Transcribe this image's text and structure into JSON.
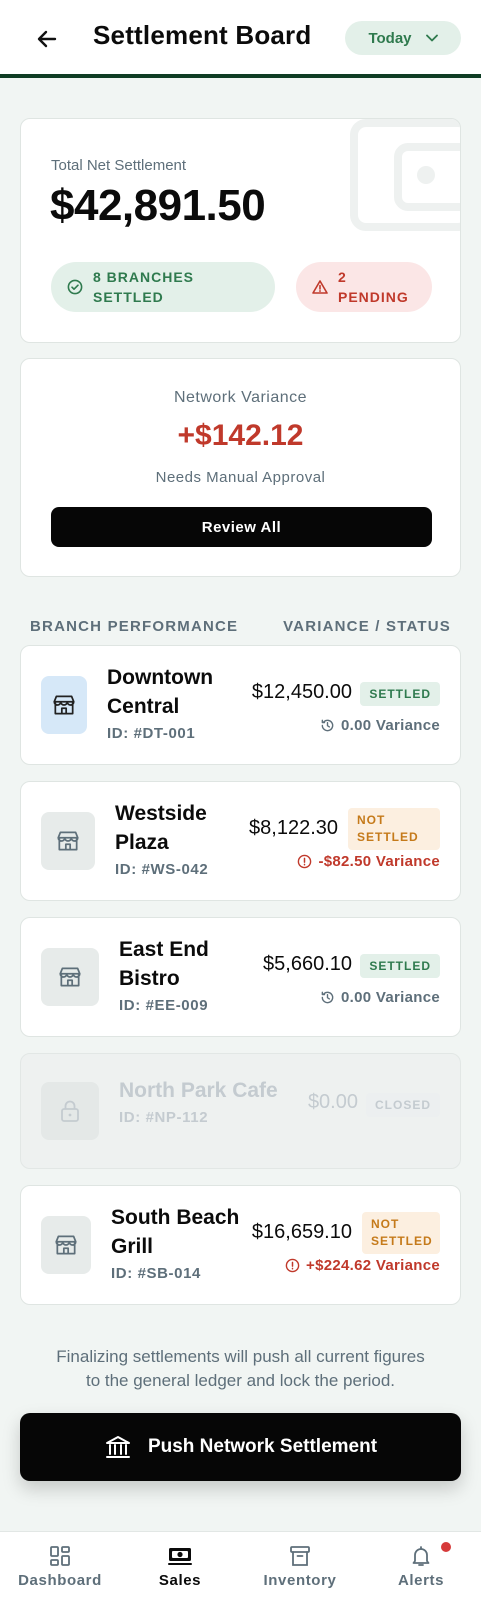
{
  "header": {
    "title": "Settlement Board",
    "date_filter": "Today"
  },
  "summary": {
    "label": "Total Net Settlement",
    "value": "$42,891.50",
    "settled_badge_line1": "8 BRANCHES",
    "settled_badge_line2": "SETTLED",
    "pending_badge_line1": "2",
    "pending_badge_line2": "PENDING"
  },
  "variance": {
    "label": "Network Variance",
    "value": "+$142.12",
    "subtitle": "Needs Manual Approval",
    "review_label": "Review All"
  },
  "section": {
    "left": "BRANCH PERFORMANCE",
    "right": "VARIANCE / STATUS"
  },
  "branches": [
    {
      "name_line1": "Downtown",
      "name_line2": "Central",
      "id": "ID: #DT-001",
      "amount": "$12,450.00",
      "status": "SETTLED",
      "variance": "0.00 Variance"
    },
    {
      "name_line1": "Westside",
      "name_line2": "Plaza",
      "id": "ID: #WS-042",
      "amount": "$8,122.30",
      "status_line1": "NOT",
      "status_line2": "SETTLED",
      "variance": "-$82.50 Variance"
    },
    {
      "name_line1": "East End",
      "name_line2": "Bistro",
      "id": "ID: #EE-009",
      "amount": "$5,660.10",
      "status": "SETTLED",
      "variance": "0.00 Variance"
    },
    {
      "name_line1": "North Park Cafe",
      "id": "ID: #NP-112",
      "amount": "$0.00",
      "status": "CLOSED"
    },
    {
      "name_line1": "South Beach",
      "name_line2": "Grill",
      "id": "ID: #SB-014",
      "amount": "$16,659.10",
      "status_line1": "NOT",
      "status_line2": "SETTLED",
      "variance": "+$224.62 Variance"
    }
  ],
  "footer": {
    "note_line1": "Finalizing settlements will push all current figures",
    "note_line2": "to the general ledger and lock the period.",
    "push_label": "Push Network Settlement"
  },
  "nav": {
    "items": [
      {
        "label": "Dashboard",
        "icon": "dashboard-icon"
      },
      {
        "label": "Sales",
        "icon": "cash-icon"
      },
      {
        "label": "Inventory",
        "icon": "archive-icon"
      },
      {
        "label": "Alerts",
        "icon": "bell-icon"
      }
    ],
    "active": "Sales"
  },
  "colors": {
    "brand_dark": "#0f3d24",
    "success": "#2f7a4e",
    "danger": "#c0392b",
    "warning": "#c57a1a",
    "muted": "#5e6f7a"
  }
}
